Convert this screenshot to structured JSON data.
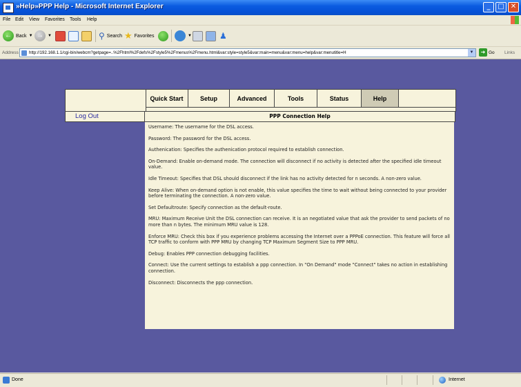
{
  "window": {
    "title": "»Help»PPP Help - Microsoft Internet Explorer",
    "controls": {
      "minimize": "_",
      "maximize": "□",
      "close": "✕"
    }
  },
  "menubar": {
    "items": [
      "File",
      "Edit",
      "View",
      "Favorites",
      "Tools",
      "Help"
    ]
  },
  "toolbar": {
    "back": "Back",
    "search": "Search",
    "favorites": "Favorites"
  },
  "address": {
    "label": "Address",
    "url": "http://192.168.1.1/cgi-bin/webcm?getpage=..%2Fhtml%2Fdefs%2Fstyle5%2Fmenus%2Fmenu.html&var:style=style5&var:main=menu&var:menu=help&var:menutitle=H",
    "go": "Go",
    "links": "Links"
  },
  "nav": {
    "tabs": [
      "Quick Start",
      "Setup",
      "Advanced",
      "Tools",
      "Status",
      "Help"
    ],
    "active": "Help"
  },
  "sidebar": {
    "logout": "Log Out"
  },
  "help": {
    "title": "PPP Connection Help",
    "paragraphs": [
      "Username: The username for the DSL access.",
      "Password: The password for the DSL access.",
      "Authenication: Specifies the authenication protocol required to establish connection.",
      "On-Demand: Enable on-demand mode. The connection will disconnect if no activity is detected after the specified idle timeout value.",
      "Idle Timeout: Specifies that DSL should disconnect if the link has no activity detected for n seconds. A non-zero value.",
      "Keep Alive: When on-demand option is not enable, this value specifies the time to wait without being connected to your provider before terminating the connection. A non-zero value.",
      "Set Defaultroute: Specify connection as the default-route.",
      "MRU: Maximum Receive Unit the DSL connection can receive. It is an negotiated value that ask the provider to send packets of no more than n bytes. The minimum MRU value is 128.",
      "Enforce MRU: Check this box if you experience problems accessing the Internet over a PPPoE connection. This feature will force all TCP traffic to conform with PPP MRU by changing TCP Maximum Segment Size to PPP MRU.",
      "Debug: Enables PPP connection debugging facilities.",
      "Connect: Use the current settings to establish a ppp connection. In \"On Demand\" mode \"Connect\" takes no action in establishing connection.",
      "Disconnect: Disconnects the ppp connection."
    ]
  },
  "status": {
    "text": "Done",
    "zone": "Internet"
  },
  "colors": {
    "page_bg": "#59599f",
    "panel_bg": "#f7f3dc",
    "active_tab": "#cfcbb5",
    "link": "#2a2aa0"
  }
}
